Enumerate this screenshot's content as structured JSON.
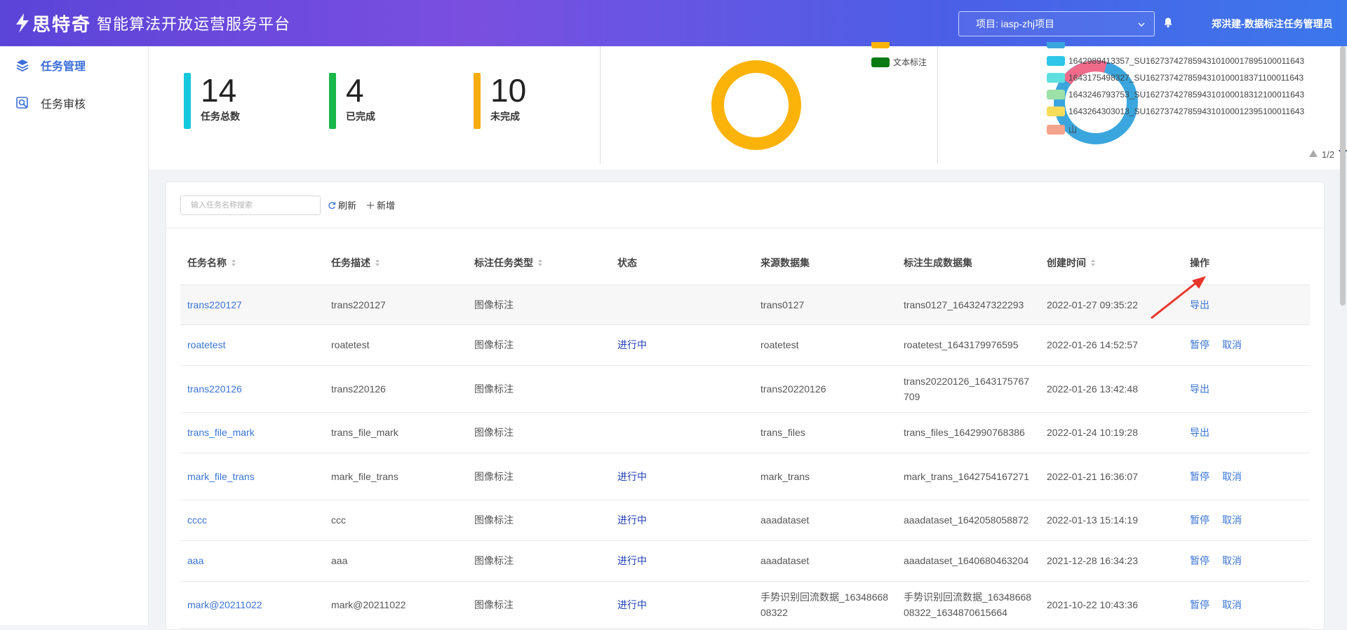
{
  "app": {
    "brand": "思特奇",
    "title": "智能算法开放运营服务平台",
    "brand_color": "#5b44d8"
  },
  "header": {
    "project_label": "项目: iasp-zhj项目",
    "user": "郑洪建-数据标注任务管理员",
    "bell_icon": "bell-icon"
  },
  "sidebar": {
    "items": [
      {
        "label": "任务管理",
        "icon": "layers-icon",
        "active": true
      },
      {
        "label": "任务审核",
        "icon": "review-icon",
        "active": false
      }
    ]
  },
  "stats": [
    {
      "value": "14",
      "label": "任务总数",
      "color": "#14c8dc"
    },
    {
      "value": "4",
      "label": "已完成",
      "color": "#18b84a"
    },
    {
      "value": "10",
      "label": "未完成",
      "color": "#f5ac0d"
    }
  ],
  "type_chart": {
    "legend": [
      {
        "label": "文本标注",
        "color": "#0a7a12"
      }
    ],
    "ring_color": "#fbb30a"
  },
  "dataset_chart": {
    "legend": [
      {
        "label": "1642989413357_SU1627374278594310100017895100011643",
        "color": "#2ec6e8"
      },
      {
        "label": "1643175498327_SU1627374278594310100018371100011643",
        "color": "#5ee0e0"
      },
      {
        "label": "1643246793753_SU1627374278594310100018312100011643",
        "color": "#9de0a8"
      },
      {
        "label": "1643264303013_SU1627374278594310100012395100011643",
        "color": "#f7dc5c"
      },
      {
        "label": "山",
        "color": "#f3a38a"
      }
    ],
    "pager": "1/2"
  },
  "toolbar": {
    "search_placeholder": "输入任务名称搜索",
    "refresh": "刷新",
    "add": "新增"
  },
  "table": {
    "headers": [
      "任务名称",
      "任务描述",
      "标注任务类型",
      "状态",
      "来源数据集",
      "标注生成数据集",
      "创建时间",
      "操作"
    ],
    "rows": [
      {
        "name": "trans220127",
        "desc": "trans220127",
        "type": "图像标注",
        "status": "",
        "source": "trans0127",
        "output": "trans0127_1643247322293",
        "time": "2022-01-27 09:35:22",
        "ops": [
          "导出"
        ]
      },
      {
        "name": "roatetest",
        "desc": "roatetest",
        "type": "图像标注",
        "status": "进行中",
        "source": "roatetest",
        "output": "roatetest_1643179976595",
        "time": "2022-01-26 14:52:57",
        "ops": [
          "暂停",
          "取消"
        ]
      },
      {
        "name": "trans220126",
        "desc": "trans220126",
        "type": "图像标注",
        "status": "",
        "source": "trans20220126",
        "output": "trans20220126_1643175767709",
        "time": "2022-01-26 13:42:48",
        "ops": [
          "导出"
        ]
      },
      {
        "name": "trans_file_mark",
        "desc": "trans_file_mark",
        "type": "图像标注",
        "status": "",
        "source": "trans_files",
        "output": "trans_files_1642990768386",
        "time": "2022-01-24 10:19:28",
        "ops": [
          "导出"
        ]
      },
      {
        "name": "mark_file_trans",
        "desc": "mark_file_trans",
        "type": "图像标注",
        "status": "进行中",
        "source": "mark_trans",
        "output": "mark_trans_1642754167271",
        "time": "2022-01-21 16:36:07",
        "ops": [
          "暂停",
          "取消"
        ]
      },
      {
        "name": "cccc",
        "desc": "ccc",
        "type": "图像标注",
        "status": "进行中",
        "source": "aaadataset",
        "output": "aaadataset_1642058058872",
        "time": "2022-01-13 15:14:19",
        "ops": [
          "暂停",
          "取消"
        ]
      },
      {
        "name": "aaa",
        "desc": "aaa",
        "type": "图像标注",
        "status": "进行中",
        "source": "aaadataset",
        "output": "aaadataset_1640680463204",
        "time": "2021-12-28 16:34:23",
        "ops": [
          "暂停",
          "取消"
        ]
      },
      {
        "name": "mark@20211022",
        "desc": "mark@20211022",
        "type": "图像标注",
        "status": "进行中",
        "source": "手势识别回流数据_1634866808322",
        "output": "手势识别回流数据_1634866808322_1634870615664",
        "time": "2021-10-22 10:43:36",
        "ops": [
          "暂停",
          "取消"
        ]
      }
    ]
  }
}
